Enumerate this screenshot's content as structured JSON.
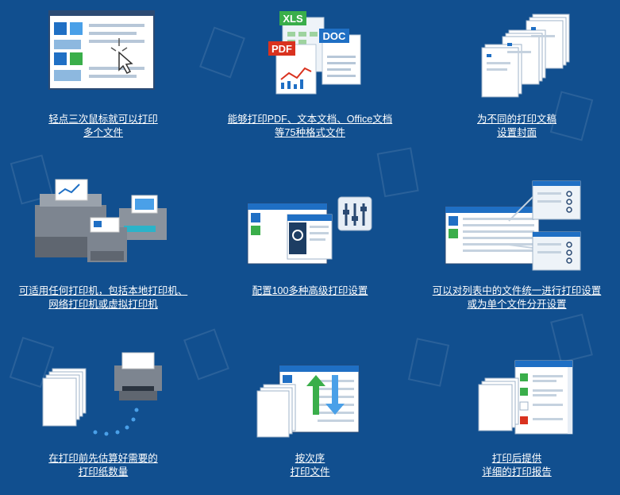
{
  "features": [
    {
      "line1": "轻点三次鼠标就可以打印",
      "line2": "多个文件",
      "icon": "monitor-click-icon"
    },
    {
      "line1": "能够打印PDF、文本文档、Office文档",
      "line2": "等75种格式文件",
      "icon": "file-formats-icon",
      "badges": {
        "pdf": "PDF",
        "xls": "XLS",
        "doc": "DOC"
      }
    },
    {
      "line1": "为不同的打印文稿",
      "line2": "设置封面",
      "icon": "cover-pages-icon"
    },
    {
      "line1": "可适用任何打印机，包括本地打印机、",
      "line2": "网络打印机或虚拟打印机",
      "icon": "printers-icon"
    },
    {
      "line1": "配置100多种高级打印设置",
      "line2": "",
      "icon": "settings-window-icon"
    },
    {
      "line1": "可以对列表中的文件统一进行打印设置",
      "line2": "或为单个文件分开设置",
      "icon": "list-settings-icon"
    },
    {
      "line1": "在打印前先估算好需要的",
      "line2": "打印纸数量",
      "icon": "paper-estimate-icon"
    },
    {
      "line1": "按次序",
      "line2": "打印文件",
      "icon": "print-order-icon"
    },
    {
      "line1": "打印后提供",
      "line2": "详细的打印报告",
      "icon": "print-report-icon"
    }
  ],
  "colors": {
    "background": "#114f8f",
    "accent_blue": "#1f6fc4",
    "green": "#3aae4a",
    "red": "#d9321f"
  }
}
